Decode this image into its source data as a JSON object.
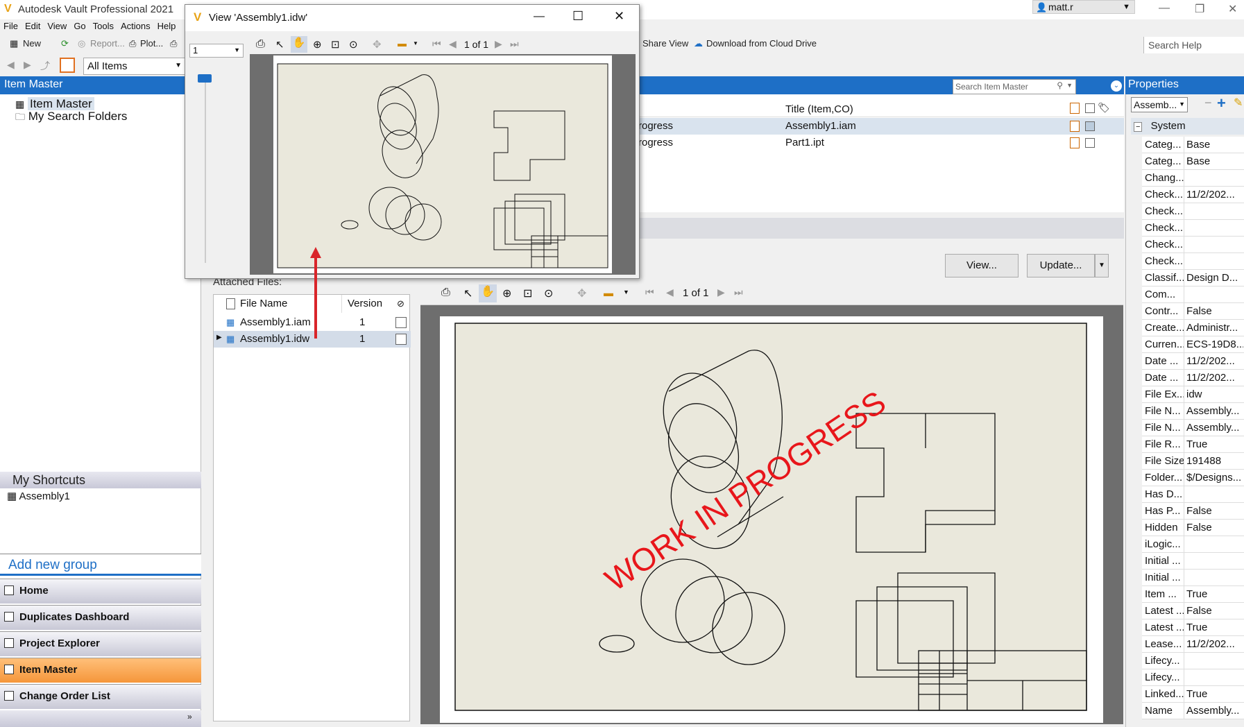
{
  "app": {
    "title": "Autodesk Vault Professional 2021",
    "user": "matt.r"
  },
  "menu": [
    "File",
    "Edit",
    "View",
    "Go",
    "Tools",
    "Actions",
    "Help"
  ],
  "toolbar": {
    "new": "New",
    "report": "Report...",
    "plot": "Plot...",
    "share_view": "Share View",
    "download_cloud": "Download from Cloud Drive",
    "search_help": "Search Help"
  },
  "nav": {
    "scope": "All Items"
  },
  "left": {
    "header": "Item Master",
    "tree": [
      "Item Master",
      "My Search Folders"
    ],
    "shortcuts_header": "My Shortcuts",
    "shortcuts": [
      "Assembly1"
    ],
    "add_group": "Add new group",
    "buttons": [
      "Home",
      "Duplicates Dashboard",
      "Project Explorer",
      "Item Master",
      "Change Order List"
    ]
  },
  "center": {
    "search_placeholder": "Search Item Master",
    "col_title": "Title (Item,CO)",
    "rows": [
      {
        "state": "rogress",
        "title": "Assembly1.iam"
      },
      {
        "state": "rogress",
        "title": "Part1.ipt"
      }
    ],
    "view_button": "View...",
    "update_button": "Update...",
    "attached_label": "Attached Files:",
    "file_headers": {
      "name": "File Name",
      "version": "Version"
    },
    "files": [
      {
        "name": "Assembly1.iam",
        "version": "1"
      },
      {
        "name": "Assembly1.idw",
        "version": "1"
      }
    ],
    "page": "1 of 1",
    "watermark": "WORK IN PROGRESS"
  },
  "popup": {
    "title": "View 'Assembly1.idw'",
    "page_select": "1",
    "page": "1 of 1"
  },
  "properties": {
    "header": "Properties",
    "selector": "Assemb...",
    "group": "System",
    "rows": [
      {
        "k": "Categ...",
        "v": "Base"
      },
      {
        "k": "Categ...",
        "v": "Base"
      },
      {
        "k": "Chang...",
        "v": ""
      },
      {
        "k": "Check...",
        "v": "11/2/202..."
      },
      {
        "k": "Check...",
        "v": ""
      },
      {
        "k": "Check...",
        "v": ""
      },
      {
        "k": "Check...",
        "v": ""
      },
      {
        "k": "Check...",
        "v": ""
      },
      {
        "k": "Classif...",
        "v": "Design D..."
      },
      {
        "k": "Com...",
        "v": ""
      },
      {
        "k": "Contr...",
        "v": "False"
      },
      {
        "k": "Create...",
        "v": "Administr..."
      },
      {
        "k": "Curren...",
        "v": "ECS-19D8..."
      },
      {
        "k": "Date ...",
        "v": "11/2/202..."
      },
      {
        "k": "Date ...",
        "v": "11/2/202..."
      },
      {
        "k": "File Ex...",
        "v": "idw"
      },
      {
        "k": "File N...",
        "v": "Assembly..."
      },
      {
        "k": "File N...",
        "v": "Assembly..."
      },
      {
        "k": "File R...",
        "v": "True"
      },
      {
        "k": "File Size",
        "v": "191488"
      },
      {
        "k": "Folder...",
        "v": "$/Designs..."
      },
      {
        "k": "Has D...",
        "v": ""
      },
      {
        "k": "Has P...",
        "v": "False"
      },
      {
        "k": "Hidden",
        "v": "False"
      },
      {
        "k": "iLogic...",
        "v": ""
      },
      {
        "k": "Initial ...",
        "v": ""
      },
      {
        "k": "Initial ...",
        "v": ""
      },
      {
        "k": "Item ...",
        "v": "True"
      },
      {
        "k": "Latest ...",
        "v": "False"
      },
      {
        "k": "Latest ...",
        "v": "True"
      },
      {
        "k": "Lease...",
        "v": "11/2/202..."
      },
      {
        "k": "Lifecy...",
        "v": ""
      },
      {
        "k": "Lifecy...",
        "v": ""
      },
      {
        "k": "Linked...",
        "v": "True"
      },
      {
        "k": "Name",
        "v": "Assembly..."
      }
    ]
  },
  "colors": {
    "accent": "#1e6fc6",
    "active_nav": "#f5963a",
    "watermark": "#e8161b",
    "arrow": "#d9252a"
  }
}
